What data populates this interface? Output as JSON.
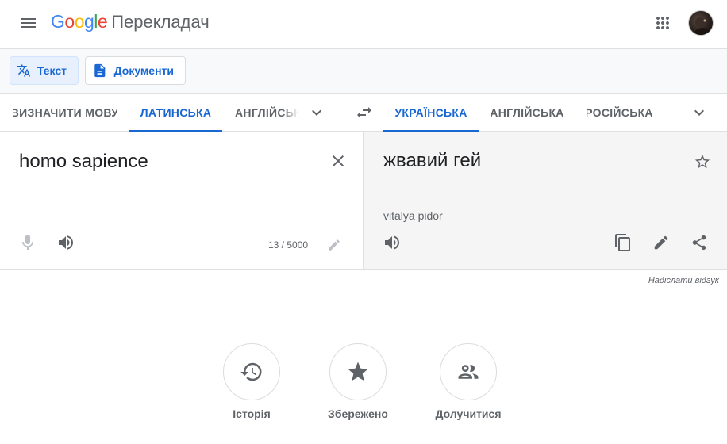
{
  "app": {
    "logo_letters": [
      "G",
      "o",
      "o",
      "g",
      "l",
      "e"
    ],
    "logo_colors": [
      "#4285f4",
      "#ea4335",
      "#fbbc05",
      "#4285f4",
      "#34a853",
      "#ea4335"
    ],
    "product_name": "Перекладач"
  },
  "modes": {
    "text_label": "Текст",
    "documents_label": "Документи"
  },
  "source_languages": [
    {
      "label": "ВИЗНАЧИТИ МОВУ",
      "active": false
    },
    {
      "label": "ЛАТИНСЬКА",
      "active": true
    },
    {
      "label": "АНГЛІЙСЬКА",
      "active": false
    }
  ],
  "target_languages": [
    {
      "label": "УКРАЇНСЬКА",
      "active": true
    },
    {
      "label": "АНГЛІЙСЬКА",
      "active": false
    },
    {
      "label": "РОСІЙСЬКА",
      "active": false
    }
  ],
  "source": {
    "text": "homo sapience",
    "char_count": "13 / 5000"
  },
  "target": {
    "text": "жвавий гей",
    "transliteration": "vitalya pidor"
  },
  "feedback_label": "Надіслати відгук",
  "quick_links": [
    {
      "label": "Історія",
      "icon": "history-icon"
    },
    {
      "label": "Збережено",
      "icon": "star-icon"
    },
    {
      "label": "Долучитися",
      "icon": "community-icon"
    }
  ],
  "colors": {
    "accent": "#1967d2",
    "icon_gray": "#5f6368"
  }
}
